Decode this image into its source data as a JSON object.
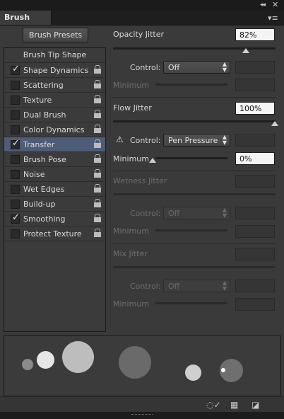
{
  "window": {
    "title": "Brush",
    "collapse_glyph": "◂◂",
    "close_glyph": "✕",
    "menu_glyph": "▾≡"
  },
  "sidebar": {
    "presets_button": "Brush Presets",
    "tip_shape_label": "Brush Tip Shape",
    "items": [
      {
        "label": "Shape Dynamics",
        "checked": true,
        "selected": false
      },
      {
        "label": "Scattering",
        "checked": false,
        "selected": false
      },
      {
        "label": "Texture",
        "checked": false,
        "selected": false
      },
      {
        "label": "Dual Brush",
        "checked": false,
        "selected": false
      },
      {
        "label": "Color Dynamics",
        "checked": false,
        "selected": false
      },
      {
        "label": "Transfer",
        "checked": true,
        "selected": true
      },
      {
        "label": "Brush Pose",
        "checked": false,
        "selected": false
      },
      {
        "label": "Noise",
        "checked": false,
        "selected": false
      },
      {
        "label": "Wet Edges",
        "checked": false,
        "selected": false
      },
      {
        "label": "Build-up",
        "checked": false,
        "selected": false
      },
      {
        "label": "Smoothing",
        "checked": true,
        "selected": false
      },
      {
        "label": "Protect Texture",
        "checked": false,
        "selected": false
      }
    ]
  },
  "settings": {
    "opacity": {
      "title": "Opacity Jitter",
      "value": "82%",
      "control_label": "Control:",
      "control_value": "Off",
      "minimum_label": "Minimum"
    },
    "flow": {
      "title": "Flow Jitter",
      "value": "100%",
      "control_label": "Control:",
      "control_value": "Pen Pressure",
      "minimum_label": "Minimum",
      "minimum_value": "0%",
      "warning_glyph": "⚠"
    },
    "wetness": {
      "title": "Wetness Jitter",
      "control_label": "Control:",
      "control_value": "Off",
      "minimum_label": "Minimum"
    },
    "mix": {
      "title": "Mix Jitter",
      "control_label": "Control:",
      "control_value": "Off",
      "minimum_label": "Minimum"
    }
  },
  "icons": {
    "check": "✓",
    "select_arrows": "⬍",
    "toggle_view": "toggle-live-tip-icon",
    "grid": "grid-icon",
    "new": "new-preset-icon"
  },
  "colors": {
    "selected_row": "#4d5c77",
    "panel_bg": "#3a3a3a"
  }
}
